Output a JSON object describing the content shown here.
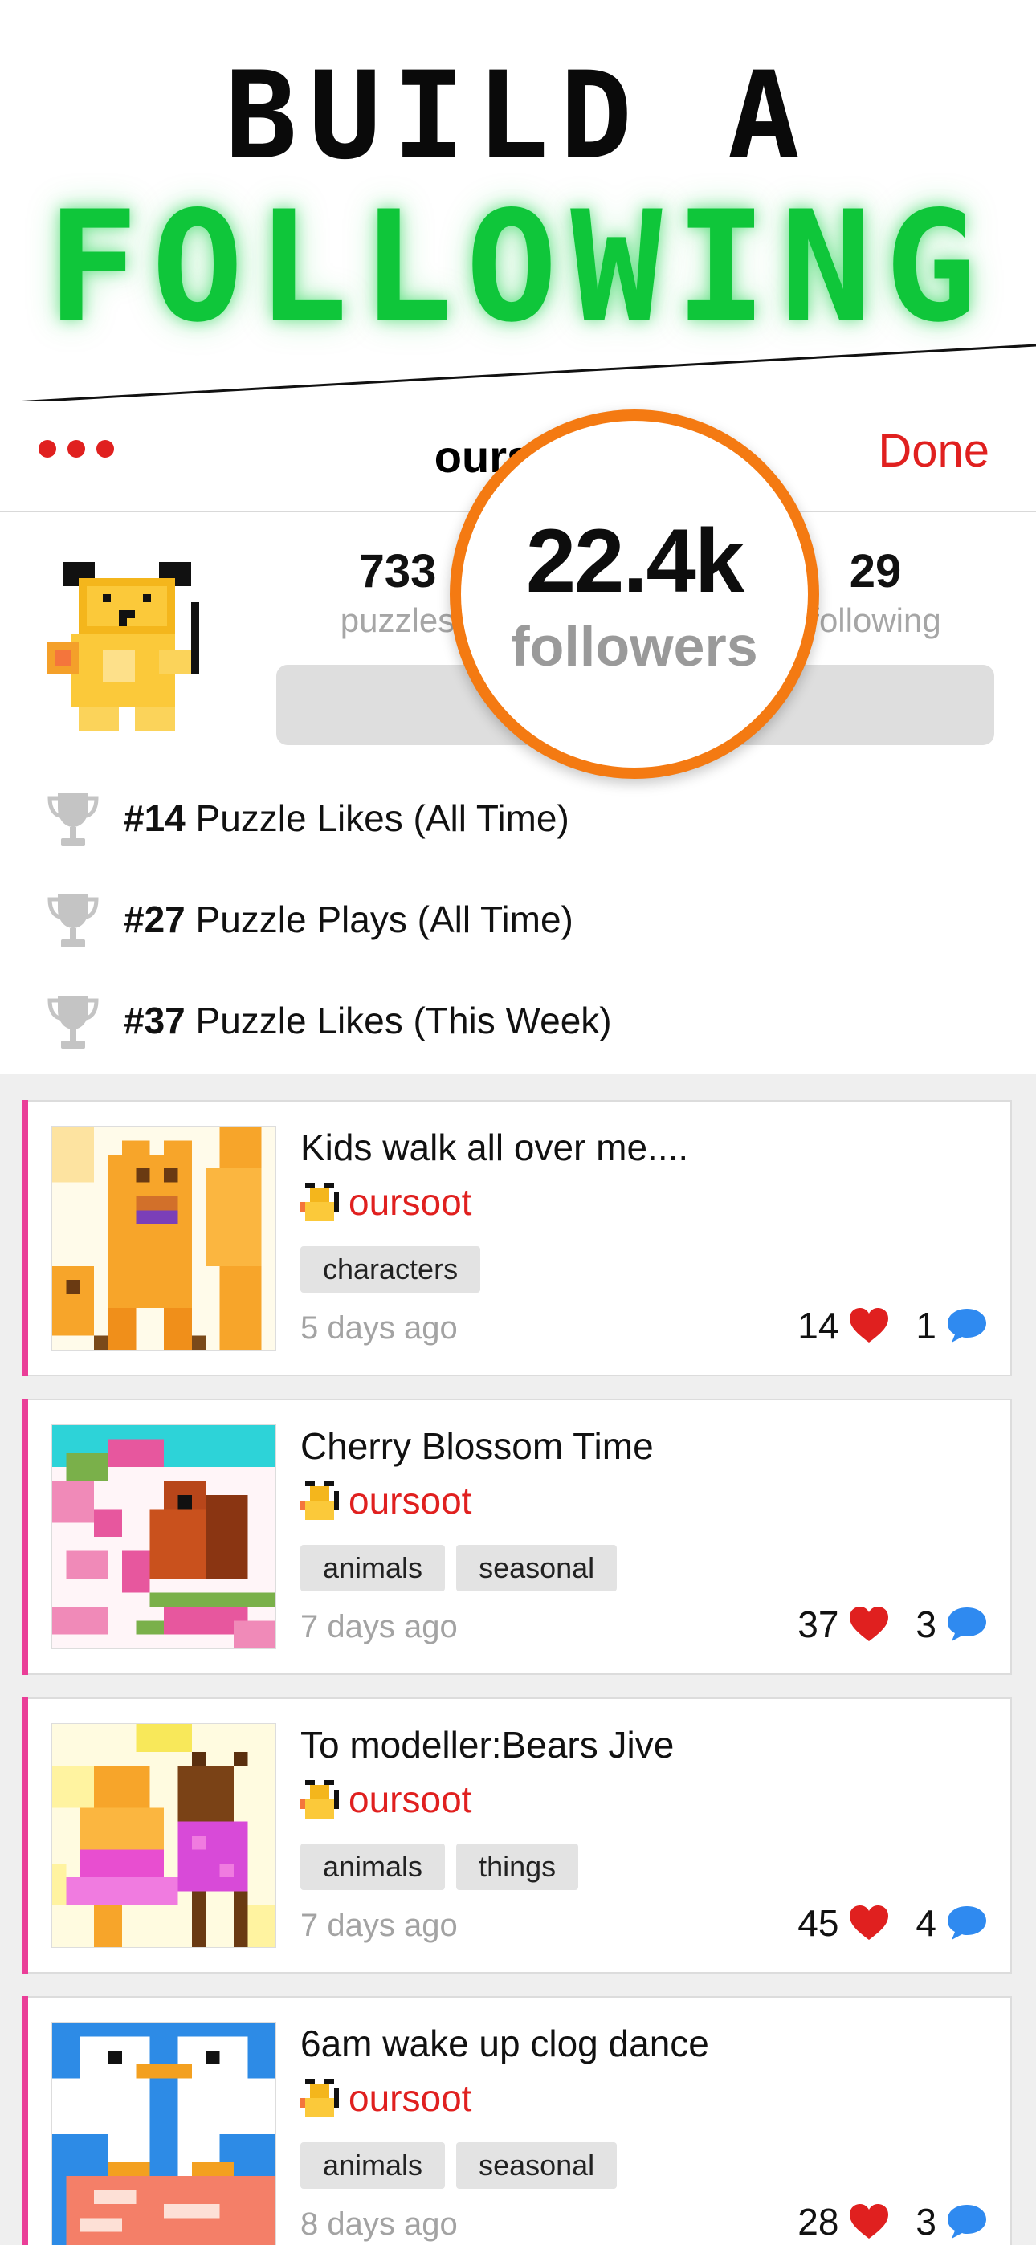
{
  "hero": {
    "line1": "BUILD A",
    "line2": "FOLLOWING"
  },
  "nav": {
    "title": "oursoot",
    "done": "Done"
  },
  "profile": {
    "puzzles_count": "733",
    "puzzles_label": "puzzles",
    "followers_count": "22.4k",
    "followers_label": "followers",
    "following_count": "29",
    "following_label": "following",
    "follow_button_label": ""
  },
  "achievements": [
    {
      "rank": "#14",
      "text": " Puzzle Likes (All Time)"
    },
    {
      "rank": "#27",
      "text": " Puzzle Plays (All Time)"
    },
    {
      "rank": "#37",
      "text": " Puzzle Likes (This Week)"
    }
  ],
  "feed": [
    {
      "title": "Kids walk all over me....",
      "author": "oursoot",
      "tags": [
        "characters"
      ],
      "time": "5 days ago",
      "likes": "14",
      "comments": "1"
    },
    {
      "title": "Cherry Blossom Time",
      "author": "oursoot",
      "tags": [
        "animals",
        "seasonal"
      ],
      "time": "7 days ago",
      "likes": "37",
      "comments": "3"
    },
    {
      "title": "To modeller:Bears Jive",
      "author": "oursoot",
      "tags": [
        "animals",
        "things"
      ],
      "time": "7 days ago",
      "likes": "45",
      "comments": "4"
    },
    {
      "title": "6am wake up clog dance",
      "author": "oursoot",
      "tags": [
        "animals",
        "seasonal"
      ],
      "time": "8 days ago",
      "likes": "28",
      "comments": "3"
    }
  ],
  "colors": {
    "accent_red": "#e0201f",
    "hero_green": "#0fc63a",
    "spotlight_orange": "#f47a12",
    "card_accent": "#ea3e98",
    "comment_blue": "#2f8af0"
  },
  "icons": [
    "more-dots-icon",
    "trophy-icon",
    "heart-icon",
    "comment-icon",
    "bear-avatar-icon"
  ]
}
